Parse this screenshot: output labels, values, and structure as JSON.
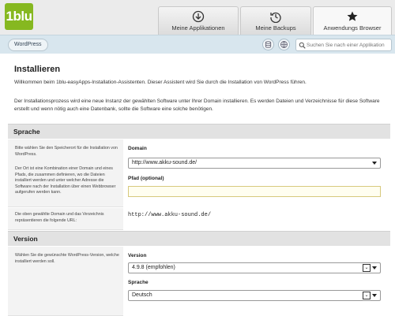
{
  "header": {
    "logo_text": "1blu",
    "tabs": [
      {
        "label": "Meine Applikationen",
        "icon": "download-circle-icon"
      },
      {
        "label": "Meine Backups",
        "icon": "history-icon"
      },
      {
        "label": "Anwendungs Browser",
        "icon": "star-icon"
      }
    ]
  },
  "breadcrumb": {
    "item": "WordPress"
  },
  "search": {
    "placeholder": "Suchen Sie nach einer Applikation"
  },
  "page": {
    "title": "Installieren",
    "intro": "Willkommen beim 1blu-easyApps-Installation-Assistenten. Dieser Assistent wird Sie durch die Installation von WordPress führen.",
    "description": "Der Installationsprozess wird eine neue Instanz der gewählten Software unter Ihrer Domain installieren. Es werden Dateien und Verzeichnisse für diese Software erstellt und wenn nötig auch eine Datenbank, sollte die Software eine solche benötigen."
  },
  "sprache_section": {
    "heading": "Sprache",
    "help1": "Bitte wählen Sie den Speicherort für die Installation von WordPress.",
    "help2": "Der Ort ist eine Kombination einer Domain und eines Pfads, die zusammen definieren, wo die Dateien installiert werden und unter welcher Adresse die Software nach der Installation über einen Webbrowser aufgerufen werden kann.",
    "domain_label": "Domain",
    "domain_value": "http://www.akku-sound.de/",
    "path_label": "Pfad (optional)",
    "path_value": "",
    "url_help": "Die oben gewählte Domain und das Verzeichnis repräsentieren die folgende URL:",
    "url_value": "http://www.akku-sound.de/"
  },
  "version_section": {
    "heading": "Version",
    "help": "Wählen Sie die gewünschte WordPress-Version, welche installiert werden soll.",
    "version_label": "Version",
    "version_value": "4.9.8 (empfohlen)",
    "language_label": "Sprache",
    "language_value": "Deutsch"
  },
  "colors": {
    "accent_green": "#86b820",
    "crumb_bar": "#d8e6ee",
    "section_header": "#e2e2e2"
  }
}
